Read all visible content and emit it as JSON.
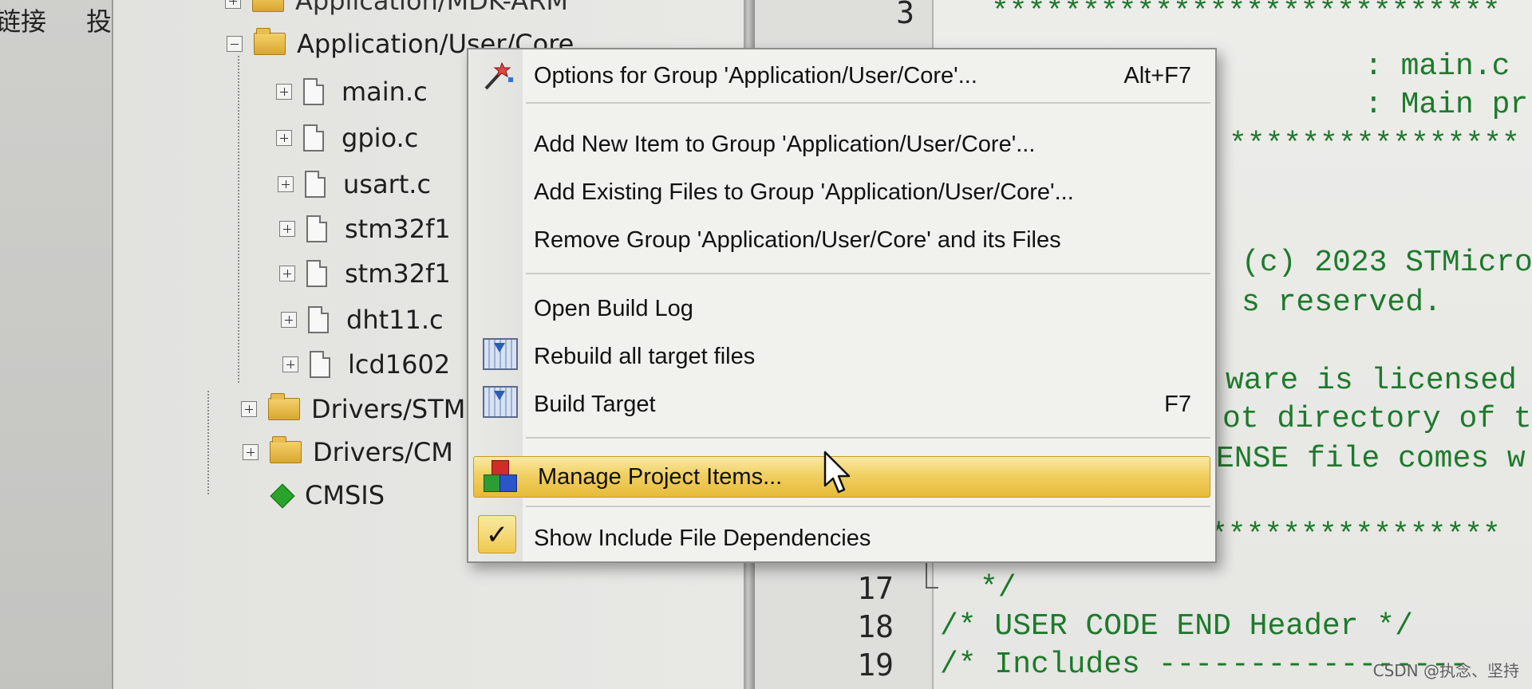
{
  "left_strip": {
    "chars": [
      "链接",
      "投"
    ]
  },
  "project_tree": {
    "top_partial": "Application/MDK-ARM",
    "group_expanded": "Application/User/Core",
    "files": [
      "main.c",
      "gpio.c",
      "usart.c",
      "stm32f1",
      "stm32f1",
      "dht11.c",
      "lcd1602"
    ],
    "groups_collapsed": [
      "Drivers/STM",
      "Drivers/CM"
    ],
    "cmsis": "CMSIS"
  },
  "editor": {
    "line_numbers": [
      "3",
      "17",
      "18",
      "19"
    ],
    "lines": {
      "l3": "****************************",
      "file": ": main.c",
      "brief": ": Main pr",
      "stars2": "****************",
      "copyright": "(c) 2023 STMicro",
      "reserved": "s reserved.",
      "licensed": "ware is licensed",
      "directory": "ot directory of t",
      "license_file": "ENSE file comes w",
      "stars3": "****************",
      "l17": "*/",
      "l18": "/* USER CODE END Header */",
      "l19": "/* Includes -----------------"
    }
  },
  "context_menu": {
    "options_group": {
      "label": "Options for Group 'Application/User/Core'...",
      "shortcut": "Alt+F7"
    },
    "add_new_item": {
      "label": "Add New  Item to Group 'Application/User/Core'..."
    },
    "add_existing": {
      "label": "Add Existing Files to Group 'Application/User/Core'..."
    },
    "remove_group": {
      "label": "Remove Group 'Application/User/Core' and its Files"
    },
    "open_build_log": {
      "label": "Open Build Log"
    },
    "rebuild_all": {
      "label": "Rebuild all target files"
    },
    "build_target": {
      "label": "Build Target",
      "shortcut": "F7"
    },
    "manage_items": {
      "label": "Manage Project Items..."
    },
    "show_include": {
      "label": "Show Include File Dependencies",
      "checked": true
    }
  },
  "watermark": "CSDN @执念、坚持",
  "colors": {
    "comment_green": "#1d7a2c",
    "highlight": "#f1d062",
    "folder": "#e8bd4e"
  }
}
